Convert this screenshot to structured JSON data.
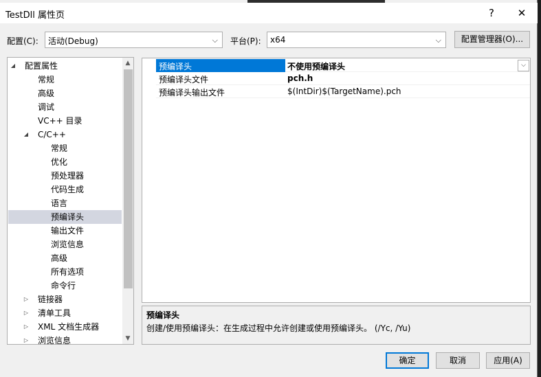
{
  "window": {
    "title": "TestDll 属性页",
    "help_label": "?",
    "close_label": "✕"
  },
  "toolbar": {
    "config_label": "配置(C):",
    "config_value": "活动(Debug)",
    "platform_label": "平台(P):",
    "platform_value": "x64",
    "config_manager_label": "配置管理器(O)..."
  },
  "tree": {
    "items": [
      {
        "label": "配置属性",
        "expander": "◢",
        "level": 0
      },
      {
        "label": "常规",
        "expander": "",
        "level": 1
      },
      {
        "label": "高级",
        "expander": "",
        "level": 1
      },
      {
        "label": "调试",
        "expander": "",
        "level": 1
      },
      {
        "label": "VC++ 目录",
        "expander": "",
        "level": 1
      },
      {
        "label": "C/C++",
        "expander": "◢",
        "level": 1
      },
      {
        "label": "常规",
        "expander": "",
        "level": 2
      },
      {
        "label": "优化",
        "expander": "",
        "level": 2
      },
      {
        "label": "预处理器",
        "expander": "",
        "level": 2
      },
      {
        "label": "代码生成",
        "expander": "",
        "level": 2
      },
      {
        "label": "语言",
        "expander": "",
        "level": 2
      },
      {
        "label": "预编译头",
        "expander": "",
        "level": 2,
        "selected": true
      },
      {
        "label": "输出文件",
        "expander": "",
        "level": 2
      },
      {
        "label": "浏览信息",
        "expander": "",
        "level": 2
      },
      {
        "label": "高级",
        "expander": "",
        "level": 2
      },
      {
        "label": "所有选项",
        "expander": "",
        "level": 2
      },
      {
        "label": "命令行",
        "expander": "",
        "level": 2
      },
      {
        "label": "链接器",
        "expander": "▷",
        "level": 1
      },
      {
        "label": "清单工具",
        "expander": "▷",
        "level": 1
      },
      {
        "label": "XML 文档生成器",
        "expander": "▷",
        "level": 1
      },
      {
        "label": "浏览信息",
        "expander": "▷",
        "level": 1
      }
    ]
  },
  "grid": {
    "rows": [
      {
        "name": "预编译头",
        "value": "不使用预编译头",
        "selected": true,
        "bold": true
      },
      {
        "name": "预编译头文件",
        "value": "pch.h",
        "bold": true
      },
      {
        "name": "预编译头输出文件",
        "value": "$(IntDir)$(TargetName).pch",
        "bold": false
      }
    ]
  },
  "description": {
    "title": "预编译头",
    "text": "创建/使用预编译头：在生成过程中允许创建或使用预编译头。      (/Yc, /Yu)"
  },
  "buttons": {
    "ok": "确定",
    "cancel": "取消",
    "apply": "应用(A)"
  },
  "colors": {
    "accent": "#0078d7",
    "selection_tree": "#d3d6e0"
  }
}
